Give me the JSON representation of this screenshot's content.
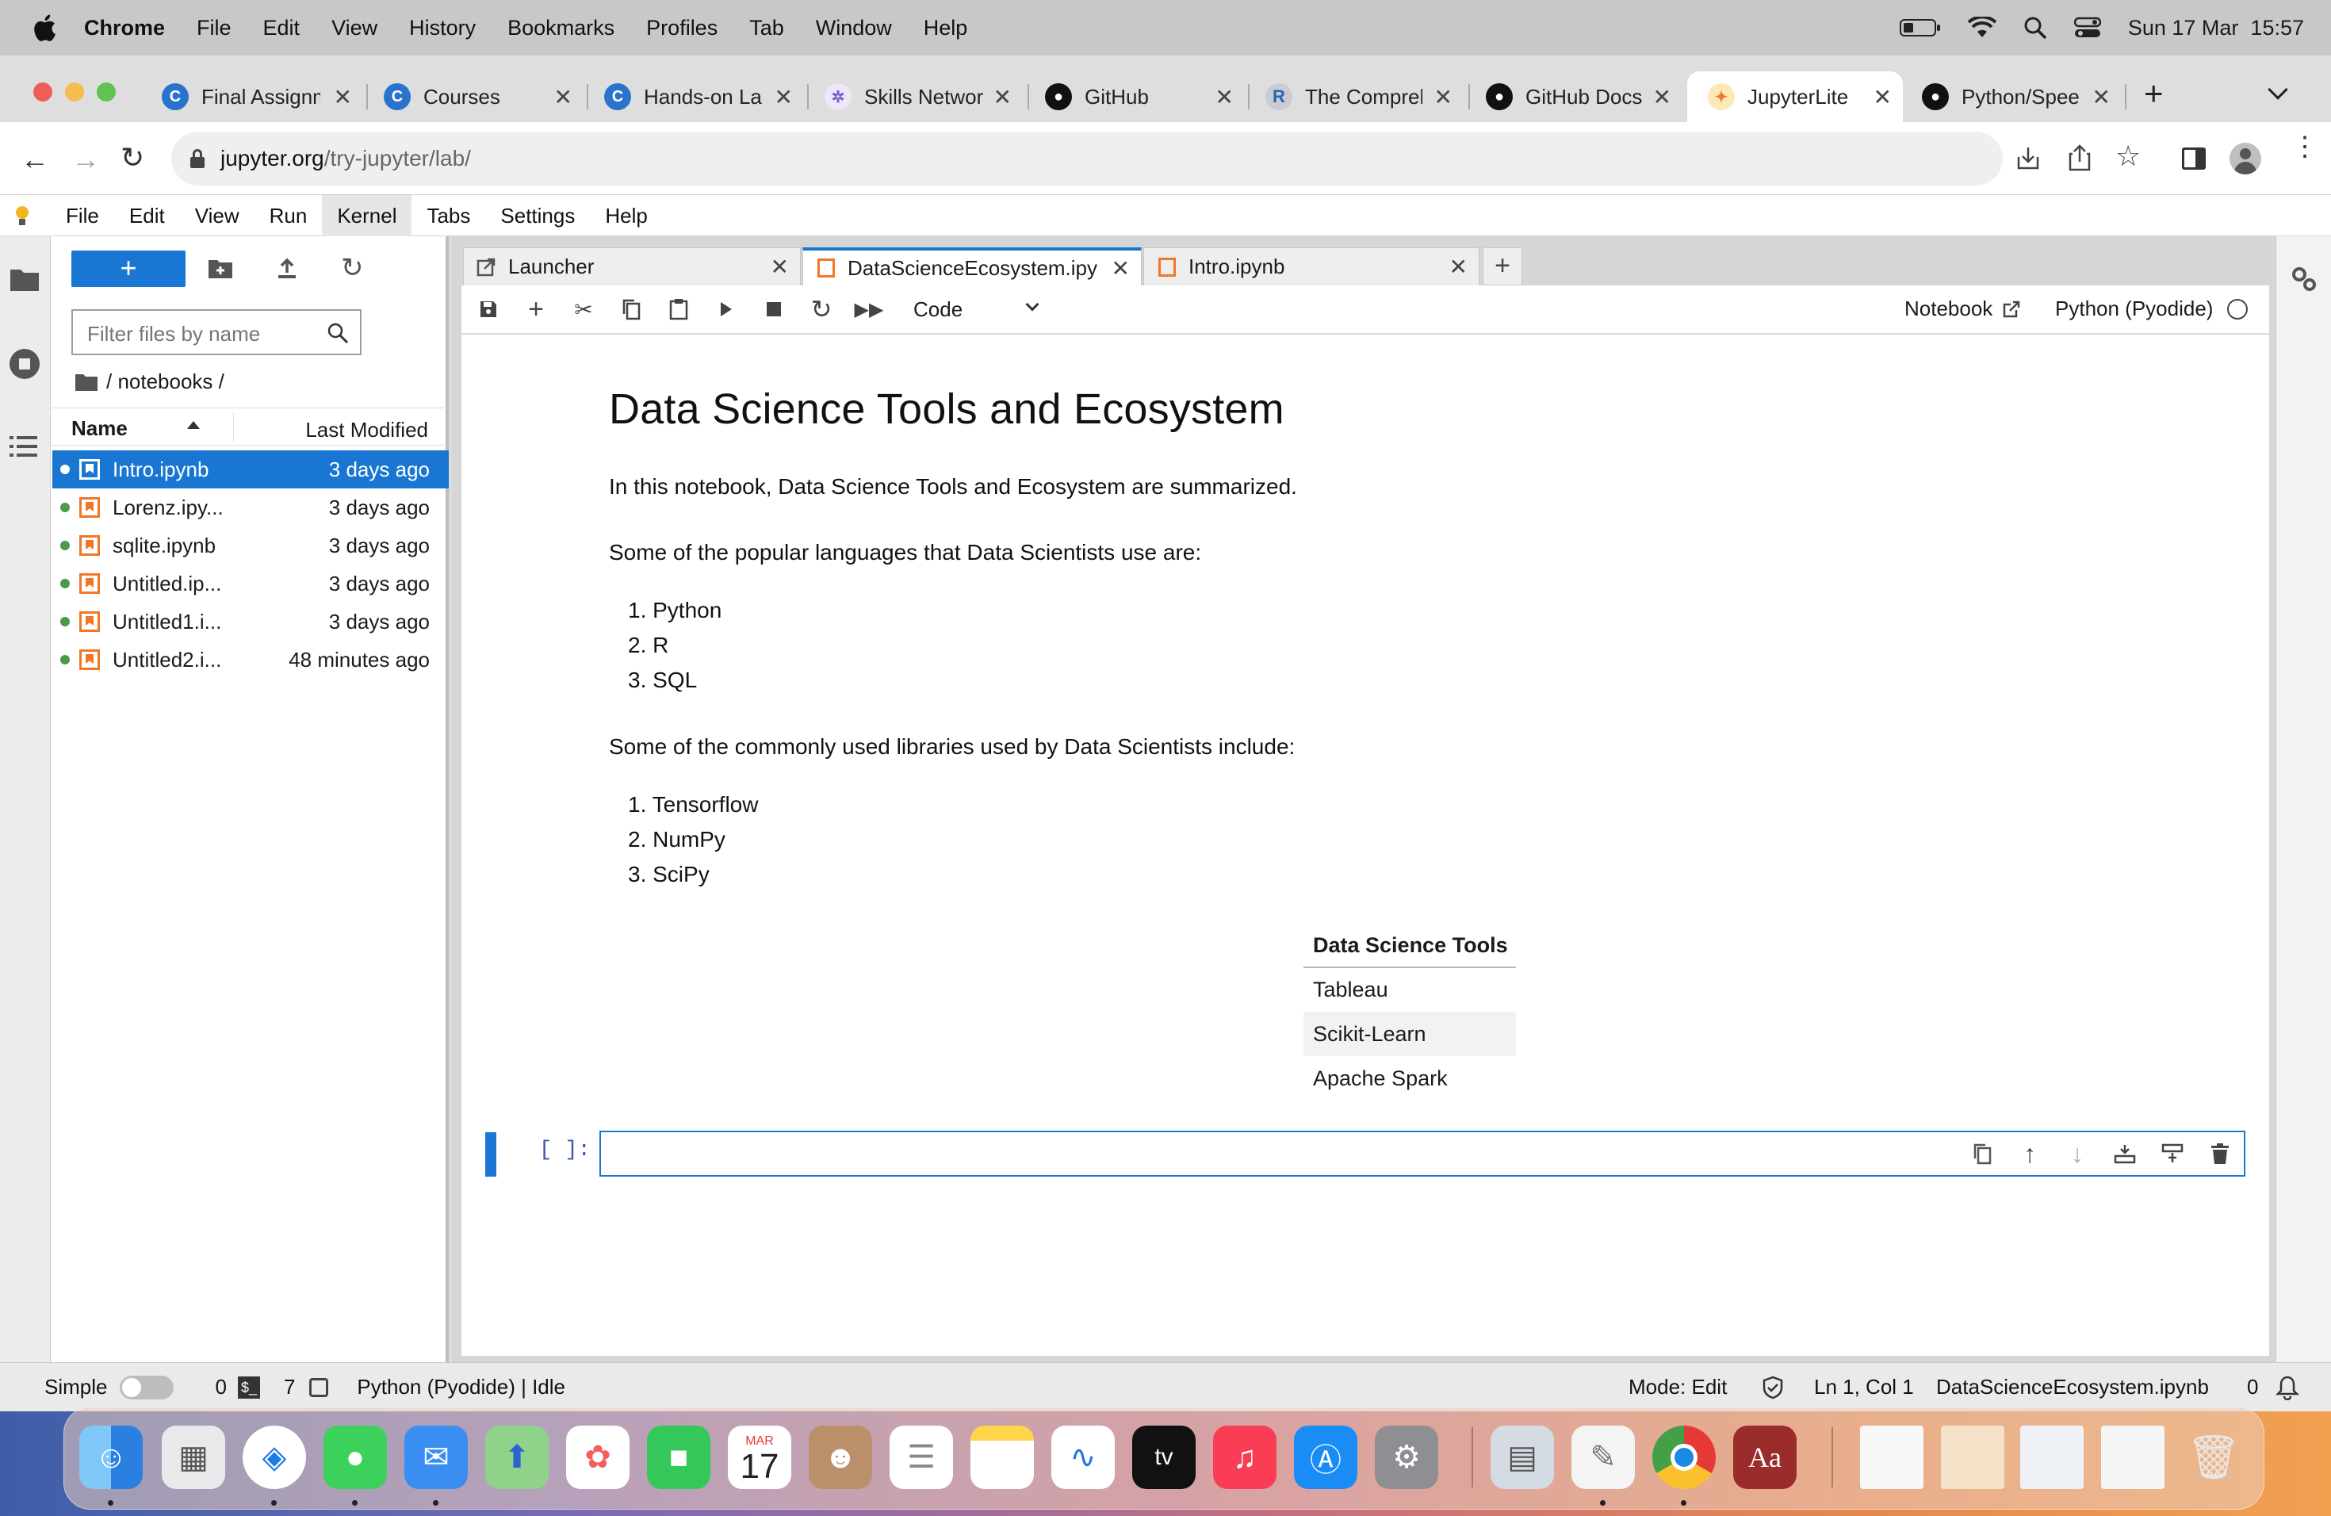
{
  "mac_menubar": {
    "app": "Chrome",
    "items": [
      "File",
      "Edit",
      "View",
      "History",
      "Bookmarks",
      "Profiles",
      "Tab",
      "Window",
      "Help"
    ],
    "clock": "Sun 17 Mar  15:57"
  },
  "browser": {
    "tabs": [
      {
        "title": "Final Assignment",
        "icon": "coursera-icon",
        "color": "#2a73cc"
      },
      {
        "title": "Courses",
        "icon": "coursera-icon",
        "color": "#2a73cc"
      },
      {
        "title": "Hands-on Lab",
        "icon": "coursera-icon",
        "color": "#2a73cc"
      },
      {
        "title": "Skills Network",
        "icon": "skills-network-icon",
        "color": "#7a5cc8"
      },
      {
        "title": "GitHub",
        "icon": "github-icon",
        "color": "#111111"
      },
      {
        "title": "The Comprehensive R",
        "icon": "r-icon",
        "color": "#2766b6"
      },
      {
        "title": "GitHub Docs",
        "icon": "github-icon",
        "color": "#111111"
      },
      {
        "title": "JupyterLite",
        "icon": "jupyter-icon",
        "color": "#f37626"
      },
      {
        "title": "Python/Speech",
        "icon": "github-icon",
        "color": "#111111"
      }
    ],
    "url_host": "jupyter.org",
    "url_path": "/try-jupyter/lab/"
  },
  "jupyter": {
    "menu": [
      "File",
      "Edit",
      "View",
      "Run",
      "Kernel",
      "Tabs",
      "Settings",
      "Help"
    ],
    "filebrowser": {
      "filter_placeholder": "Filter files by name",
      "breadcrumb": "/ notebooks /",
      "col_name": "Name",
      "col_modified": "Last Modified",
      "files": [
        {
          "name": "Intro.ipynb",
          "modified": "3 days ago"
        },
        {
          "name": "Lorenz.ipy...",
          "modified": "3 days ago"
        },
        {
          "name": "sqlite.ipynb",
          "modified": "3 days ago"
        },
        {
          "name": "Untitled.ip...",
          "modified": "3 days ago"
        },
        {
          "name": "Untitled1.i...",
          "modified": "3 days ago"
        },
        {
          "name": "Untitled2.i...",
          "modified": "48 minutes ago"
        }
      ]
    },
    "doc_tabs": [
      "Launcher",
      "DataScienceEcosystem.ipy",
      "Intro.ipynb"
    ],
    "toolbar": {
      "cell_type": "Code",
      "notebook_label": "Notebook",
      "kernel_label": "Python (Pyodide)"
    },
    "notebook": {
      "title": "Data Science Tools and Ecosystem",
      "intro": "In this notebook, Data Science Tools and Ecosystem are summarized.",
      "languages_heading": "Some of the popular languages that Data Scientists use are:",
      "languages": [
        "1. Python",
        "2. R",
        "3. SQL"
      ],
      "libraries_heading": "Some of the commonly used libraries used by Data Scientists include:",
      "libraries": [
        "1. Tensorflow",
        "2. NumPy",
        "3. SciPy"
      ],
      "table_header": "Data Science Tools",
      "table_rows": [
        "Tableau",
        "Scikit-Learn",
        "Apache Spark"
      ],
      "prompt": "[ ]:"
    },
    "status": {
      "simple": "Simple",
      "count_a": "0",
      "count_b": "7",
      "kernel": "Python (Pyodide) | Idle",
      "mode": "Mode: Edit",
      "position": "Ln 1, Col 1",
      "filename": "DataScienceEcosystem.ipynb",
      "notifications": "0"
    }
  },
  "dock": {
    "calendar_month": "MAR",
    "calendar_day": "17",
    "tv_label": "tv"
  }
}
